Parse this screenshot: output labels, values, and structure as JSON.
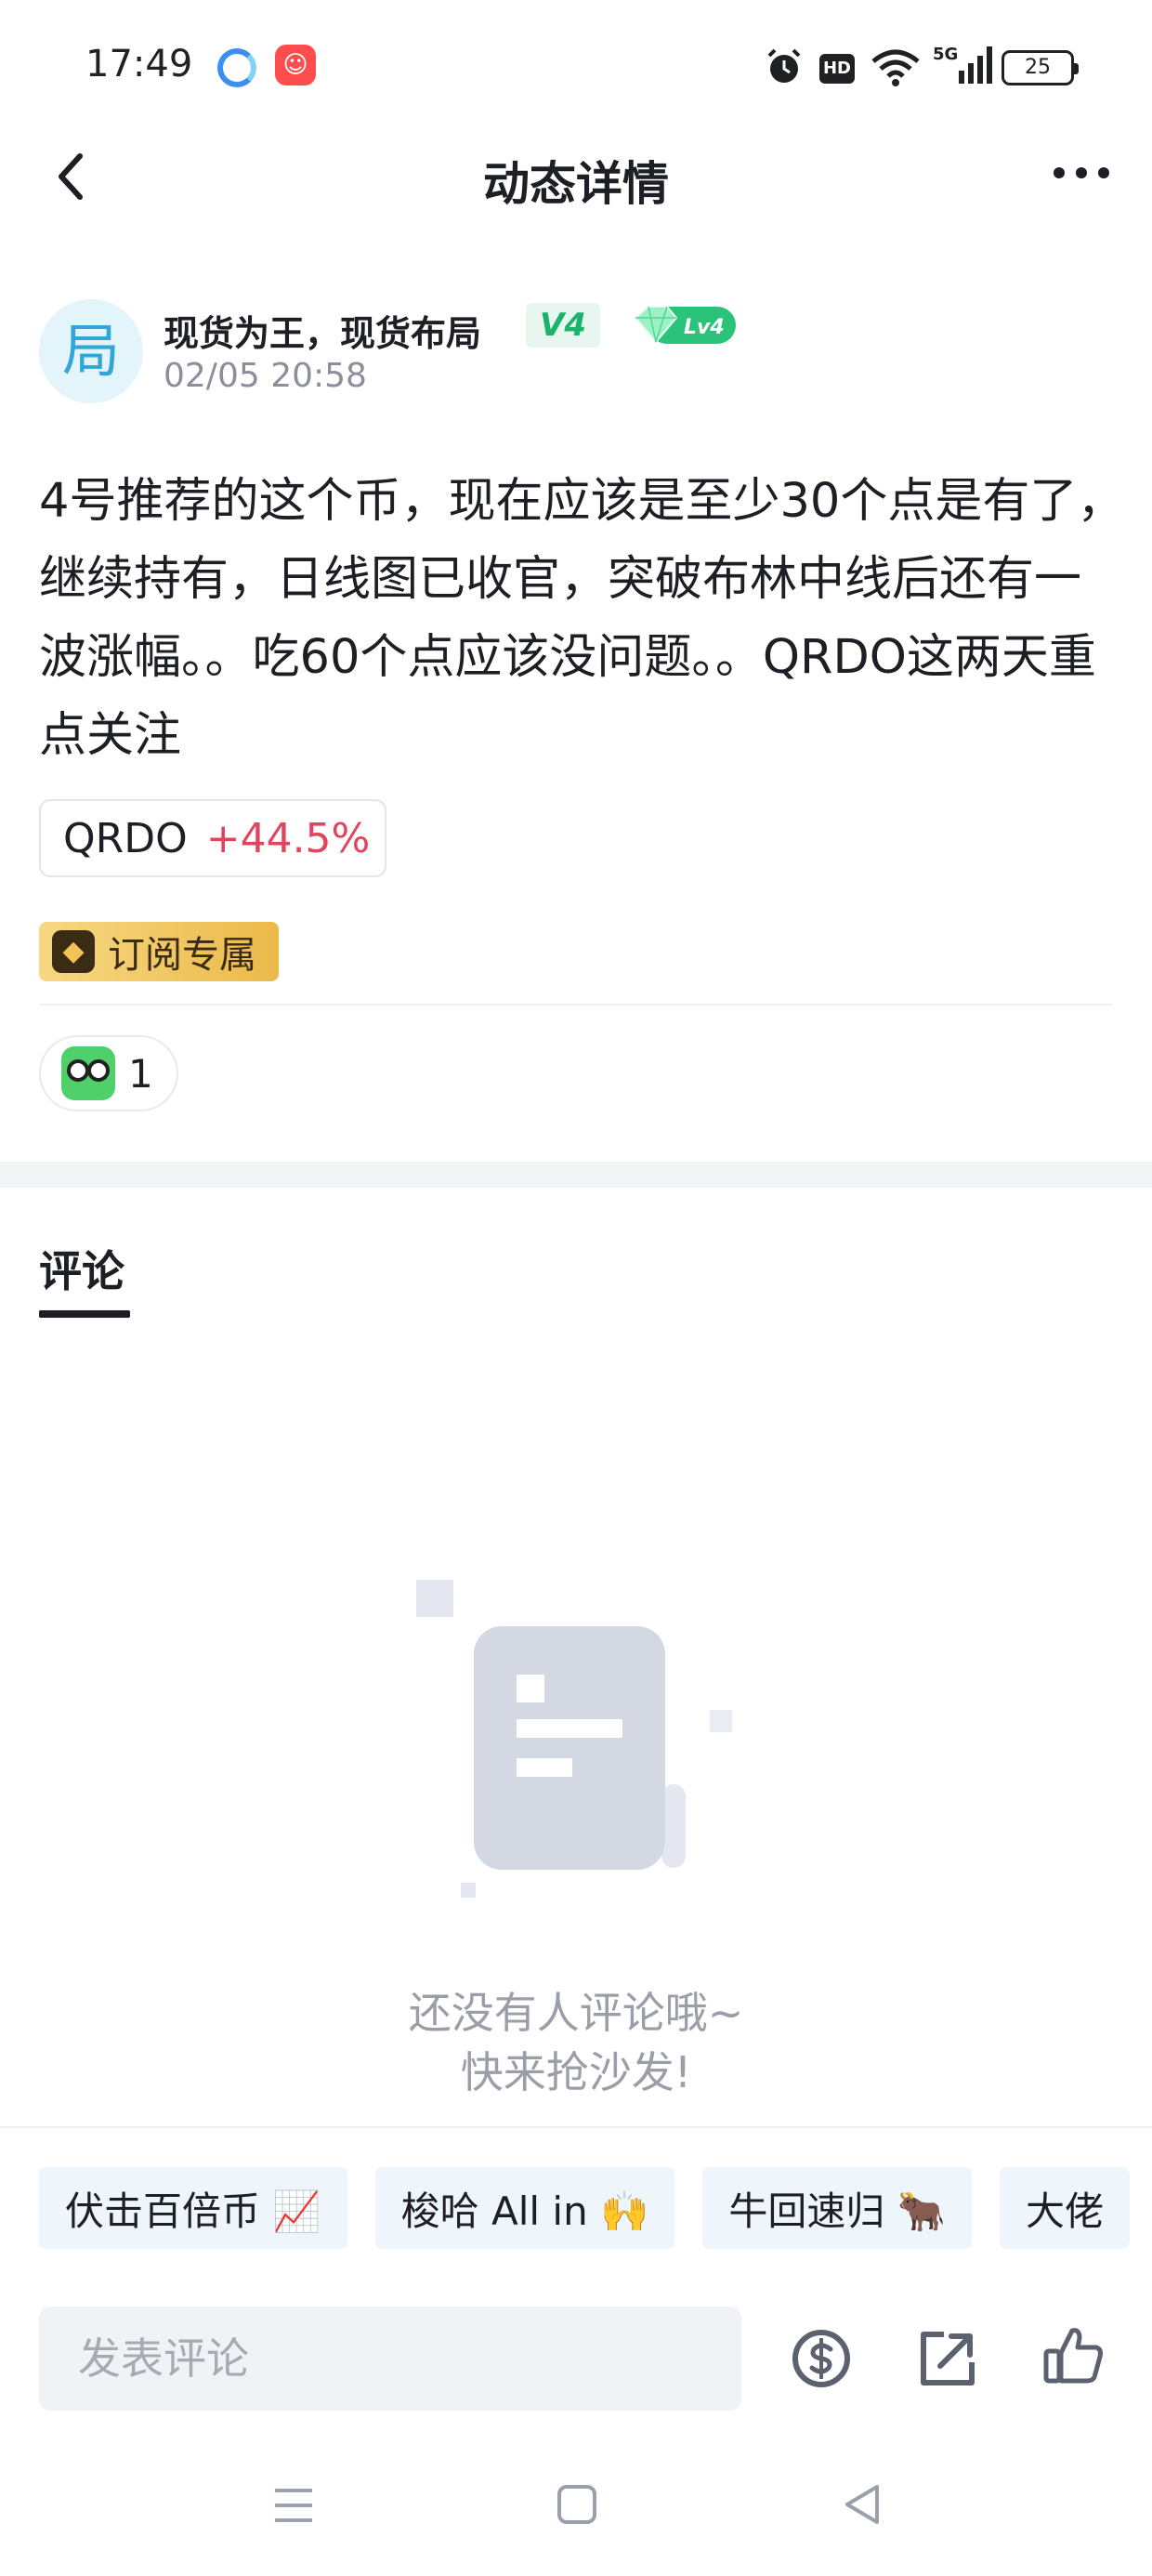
{
  "status_bar": {
    "time": "17:49",
    "network": "5G",
    "hd": "HD",
    "battery": "25"
  },
  "header": {
    "title": "动态详情",
    "back_icon": "chevron-left-icon",
    "more_icon": "more-horizontal-icon"
  },
  "author": {
    "avatar_text": "局",
    "name": "现货为王，现货布局",
    "v_badge": "V4",
    "level_badge": "Lv4",
    "time": "02/05 20:58"
  },
  "post": {
    "body": "4号推荐的这个币，现在应该是至少30个点是有了，继续持有，日线图已收官，突破布林中线后还有一波涨幅。。吃60个点应该没问题。。QRDO这两天重点关注",
    "coin_tag": {
      "name": "QRDO",
      "change": "+44.5%"
    },
    "subscription_badge": "订阅专属",
    "reaction": {
      "count": "1",
      "emoji": "green-monster-emoji"
    }
  },
  "comments": {
    "tab_label": "评论",
    "empty_line1": "还没有人评论哦~",
    "empty_line2": "快来抢沙发!"
  },
  "quick_chips": [
    {
      "label": "伏击百倍币 📈"
    },
    {
      "label": "梭哈 All in 🙌"
    },
    {
      "label": "牛回速归 🐂"
    },
    {
      "label": "大佬"
    }
  ],
  "comment_bar": {
    "placeholder": "发表评论",
    "icons": [
      "coin-icon",
      "share-icon",
      "thumbs-up-icon"
    ]
  },
  "colors": {
    "accent_green": "#1bb36b",
    "price_up_red": "#e2455b",
    "subscription_gold": "#ebb94a"
  }
}
